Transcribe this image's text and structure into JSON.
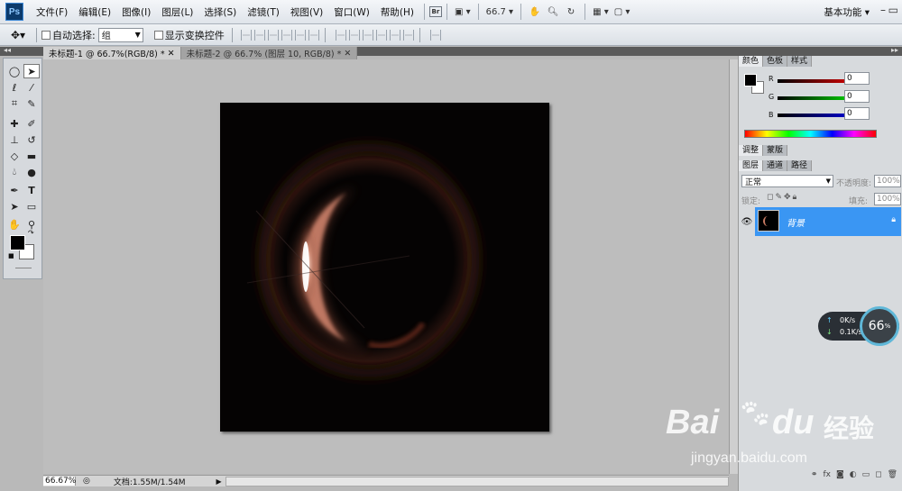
{
  "app": {
    "logo": "Ps"
  },
  "menu": [
    "文件(F)",
    "编辑(E)",
    "图像(I)",
    "图层(L)",
    "选择(S)",
    "滤镜(T)",
    "视图(V)",
    "窗口(W)",
    "帮助(H)"
  ],
  "menubar": {
    "zoom": "66.7",
    "workspace": "基本功能"
  },
  "options": {
    "auto_select_label": "自动选择:",
    "auto_select_value": "组",
    "transform_label": "显示变换控件"
  },
  "tabs": [
    {
      "label": "未标题-1 @ 66.7%(RGB/8) *"
    },
    {
      "label": "未标题-2 @ 66.7% (图层 10, RGB/8) *"
    }
  ],
  "status": {
    "zoom": "66.67%",
    "doc": "文档:1.55M/1.54M"
  },
  "color_panel": {
    "tabs": [
      "颜色",
      "色板",
      "样式"
    ],
    "r_label": "R",
    "g_label": "G",
    "b_label": "B",
    "r": "0",
    "g": "0",
    "b": "0",
    "foreground": "#000000",
    "background": "#ffffff"
  },
  "adjust_panel": {
    "tabs": [
      "调整",
      "蒙版"
    ]
  },
  "layers_panel": {
    "tabs": [
      "图层",
      "通道",
      "路径"
    ],
    "blend_mode": "正常",
    "opacity_label": "不透明度:",
    "opacity": "100%",
    "lock_label": "锁定:",
    "fill_label": "填充:",
    "fill": "100%",
    "layer_name": "背景"
  },
  "net": {
    "up": "0K/s",
    "down": "0.1K/s",
    "pct": "66",
    "pct_unit": "%"
  },
  "watermark": {
    "brand": "Bai",
    "brand2": "du",
    "cn": "经验",
    "url": "jingyan.baidu.com"
  }
}
